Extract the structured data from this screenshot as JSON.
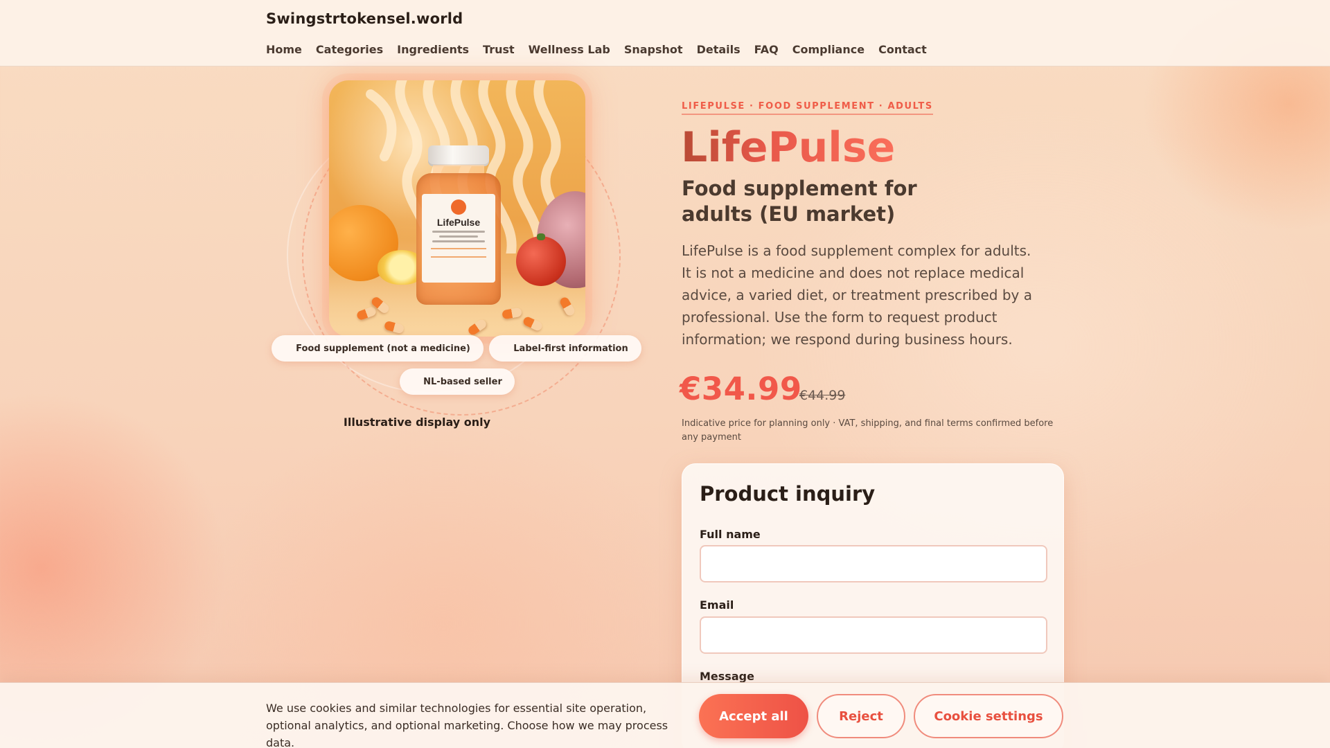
{
  "site": {
    "brand": "Swingstrtokensel.world"
  },
  "nav": {
    "items": [
      {
        "label": "Home"
      },
      {
        "label": "Categories"
      },
      {
        "label": "Ingredients"
      },
      {
        "label": "Trust"
      },
      {
        "label": "Wellness Lab"
      },
      {
        "label": "Snapshot"
      },
      {
        "label": "Details"
      },
      {
        "label": "FAQ"
      },
      {
        "label": "Compliance"
      },
      {
        "label": "Contact"
      }
    ]
  },
  "visual": {
    "bottle_label": "LifePulse",
    "badges": [
      {
        "label": "Food supplement (not a medicine)"
      },
      {
        "label": "Label-first information"
      },
      {
        "label": "NL-based seller"
      }
    ],
    "display_note": "Illustrative display only"
  },
  "product": {
    "eyebrow": "LIFEPULSE · FOOD SUPPLEMENT · ADULTS",
    "name": "LifePulse",
    "subtitle": "Food supplement for adults (EU market)",
    "description": "LifePulse is a food supplement complex for adults. It is not a medicine and does not replace medical advice, a varied diet, or treatment prescribed by a professional. Use the form to request product information; we respond during business hours.",
    "price": "€34.99",
    "old_price": "€44.99",
    "price_note": "Indicative price for planning only · VAT, shipping, and final terms confirmed before any payment"
  },
  "form": {
    "title": "Product inquiry",
    "fields": {
      "full_name": {
        "label": "Full name",
        "value": ""
      },
      "email": {
        "label": "Email",
        "value": ""
      },
      "message": {
        "label": "Message"
      }
    }
  },
  "cookie": {
    "text": "We use cookies and similar technologies for essential site operation, optional analytics, and optional marketing. Choose how we may process data.",
    "accept": "Accept all",
    "reject": "Reject",
    "settings": "Cookie settings"
  },
  "colors": {
    "accent": "#ef5c48",
    "accent_gradient_start": "#fb7254",
    "accent_gradient_end": "#ee5246",
    "background": "#f8d4bb",
    "text_dark": "#2a1e17"
  }
}
